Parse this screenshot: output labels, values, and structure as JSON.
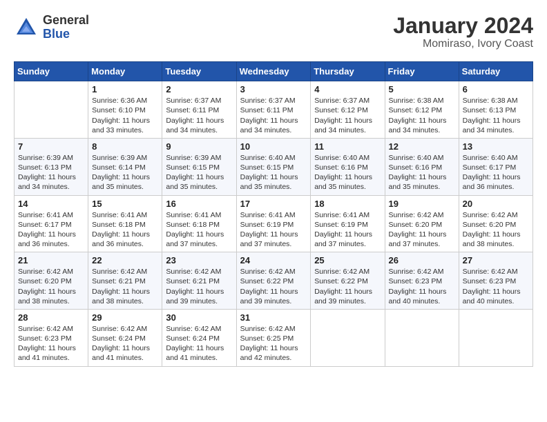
{
  "header": {
    "logo_general": "General",
    "logo_blue": "Blue",
    "title": "January 2024",
    "subtitle": "Momiraso, Ivory Coast"
  },
  "days_of_week": [
    "Sunday",
    "Monday",
    "Tuesday",
    "Wednesday",
    "Thursday",
    "Friday",
    "Saturday"
  ],
  "weeks": [
    [
      {
        "day": "",
        "content": ""
      },
      {
        "day": "1",
        "content": "Sunrise: 6:36 AM\nSunset: 6:10 PM\nDaylight: 11 hours and 33 minutes."
      },
      {
        "day": "2",
        "content": "Sunrise: 6:37 AM\nSunset: 6:11 PM\nDaylight: 11 hours and 34 minutes."
      },
      {
        "day": "3",
        "content": "Sunrise: 6:37 AM\nSunset: 6:11 PM\nDaylight: 11 hours and 34 minutes."
      },
      {
        "day": "4",
        "content": "Sunrise: 6:37 AM\nSunset: 6:12 PM\nDaylight: 11 hours and 34 minutes."
      },
      {
        "day": "5",
        "content": "Sunrise: 6:38 AM\nSunset: 6:12 PM\nDaylight: 11 hours and 34 minutes."
      },
      {
        "day": "6",
        "content": "Sunrise: 6:38 AM\nSunset: 6:13 PM\nDaylight: 11 hours and 34 minutes."
      }
    ],
    [
      {
        "day": "7",
        "content": "Sunrise: 6:39 AM\nSunset: 6:13 PM\nDaylight: 11 hours and 34 minutes."
      },
      {
        "day": "8",
        "content": "Sunrise: 6:39 AM\nSunset: 6:14 PM\nDaylight: 11 hours and 35 minutes."
      },
      {
        "day": "9",
        "content": "Sunrise: 6:39 AM\nSunset: 6:15 PM\nDaylight: 11 hours and 35 minutes."
      },
      {
        "day": "10",
        "content": "Sunrise: 6:40 AM\nSunset: 6:15 PM\nDaylight: 11 hours and 35 minutes."
      },
      {
        "day": "11",
        "content": "Sunrise: 6:40 AM\nSunset: 6:16 PM\nDaylight: 11 hours and 35 minutes."
      },
      {
        "day": "12",
        "content": "Sunrise: 6:40 AM\nSunset: 6:16 PM\nDaylight: 11 hours and 35 minutes."
      },
      {
        "day": "13",
        "content": "Sunrise: 6:40 AM\nSunset: 6:17 PM\nDaylight: 11 hours and 36 minutes."
      }
    ],
    [
      {
        "day": "14",
        "content": "Sunrise: 6:41 AM\nSunset: 6:17 PM\nDaylight: 11 hours and 36 minutes."
      },
      {
        "day": "15",
        "content": "Sunrise: 6:41 AM\nSunset: 6:18 PM\nDaylight: 11 hours and 36 minutes."
      },
      {
        "day": "16",
        "content": "Sunrise: 6:41 AM\nSunset: 6:18 PM\nDaylight: 11 hours and 37 minutes."
      },
      {
        "day": "17",
        "content": "Sunrise: 6:41 AM\nSunset: 6:19 PM\nDaylight: 11 hours and 37 minutes."
      },
      {
        "day": "18",
        "content": "Sunrise: 6:41 AM\nSunset: 6:19 PM\nDaylight: 11 hours and 37 minutes."
      },
      {
        "day": "19",
        "content": "Sunrise: 6:42 AM\nSunset: 6:20 PM\nDaylight: 11 hours and 37 minutes."
      },
      {
        "day": "20",
        "content": "Sunrise: 6:42 AM\nSunset: 6:20 PM\nDaylight: 11 hours and 38 minutes."
      }
    ],
    [
      {
        "day": "21",
        "content": "Sunrise: 6:42 AM\nSunset: 6:20 PM\nDaylight: 11 hours and 38 minutes."
      },
      {
        "day": "22",
        "content": "Sunrise: 6:42 AM\nSunset: 6:21 PM\nDaylight: 11 hours and 38 minutes."
      },
      {
        "day": "23",
        "content": "Sunrise: 6:42 AM\nSunset: 6:21 PM\nDaylight: 11 hours and 39 minutes."
      },
      {
        "day": "24",
        "content": "Sunrise: 6:42 AM\nSunset: 6:22 PM\nDaylight: 11 hours and 39 minutes."
      },
      {
        "day": "25",
        "content": "Sunrise: 6:42 AM\nSunset: 6:22 PM\nDaylight: 11 hours and 39 minutes."
      },
      {
        "day": "26",
        "content": "Sunrise: 6:42 AM\nSunset: 6:23 PM\nDaylight: 11 hours and 40 minutes."
      },
      {
        "day": "27",
        "content": "Sunrise: 6:42 AM\nSunset: 6:23 PM\nDaylight: 11 hours and 40 minutes."
      }
    ],
    [
      {
        "day": "28",
        "content": "Sunrise: 6:42 AM\nSunset: 6:23 PM\nDaylight: 11 hours and 41 minutes."
      },
      {
        "day": "29",
        "content": "Sunrise: 6:42 AM\nSunset: 6:24 PM\nDaylight: 11 hours and 41 minutes."
      },
      {
        "day": "30",
        "content": "Sunrise: 6:42 AM\nSunset: 6:24 PM\nDaylight: 11 hours and 41 minutes."
      },
      {
        "day": "31",
        "content": "Sunrise: 6:42 AM\nSunset: 6:25 PM\nDaylight: 11 hours and 42 minutes."
      },
      {
        "day": "",
        "content": ""
      },
      {
        "day": "",
        "content": ""
      },
      {
        "day": "",
        "content": ""
      }
    ]
  ]
}
